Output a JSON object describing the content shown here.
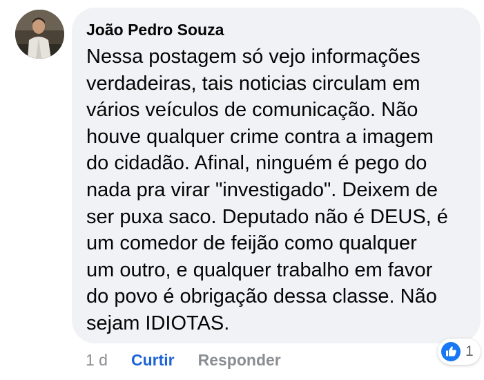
{
  "comment": {
    "author": "João Pedro Souza",
    "lines": [
      "Nessa postagem só vejo informações",
      "verdadeiras, tais noticias circulam em",
      "vários veículos de comunicação. Não",
      "houve qualquer crime contra a imagem",
      "do cidadão. Afinal, ninguém é pego do",
      "nada pra virar \"investigado\". Deixem de",
      "ser puxa saco. Deputado não é DEUS, é",
      "um comedor de feijão como qualquer",
      "um outro, e qualquer trabalho em favor",
      "do povo é obrigação dessa classe. Não",
      "sejam IDIOTAS."
    ],
    "time": "1 d",
    "like_label": "Curtir",
    "reply_label": "Responder",
    "reaction_count": "1",
    "reaction_icon": "thumbs-up-icon"
  },
  "colors": {
    "bubble": "#f0f2f5",
    "text": "#050505",
    "muted": "#8a8d91",
    "accent": "#1c63d6"
  }
}
